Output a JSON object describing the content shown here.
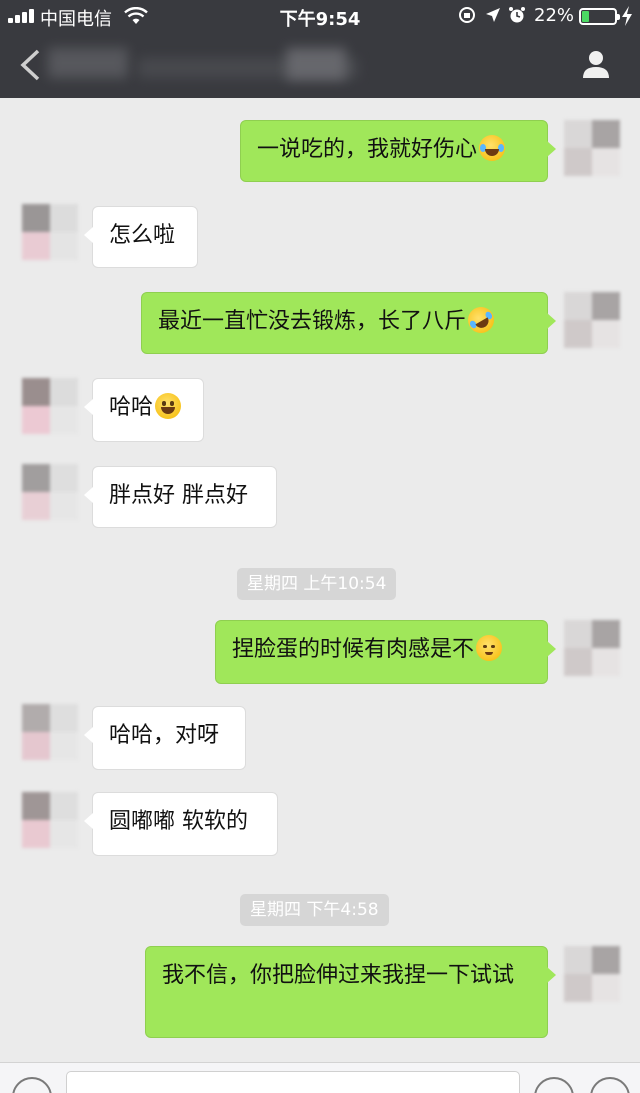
{
  "status_bar": {
    "carrier": "中国电信",
    "time": "下午9:54",
    "battery_percent": "22%",
    "battery_level": 0.22,
    "icons": [
      "signal-icon",
      "wifi-icon",
      "rotation-lock-icon",
      "location-icon",
      "alarm-icon",
      "battery-icon",
      "charging-icon"
    ]
  },
  "nav_bar": {
    "icons": [
      "back-chevron-icon",
      "person-icon"
    ]
  },
  "messages": [
    {
      "side": "out",
      "text": "一说吃的，我就好伤心",
      "emoji": "laugh-cry-emoji-icon"
    },
    {
      "side": "in",
      "text": "怎么啦"
    },
    {
      "side": "out",
      "text": "最近一直忙没去锻炼，长了八斤",
      "emoji": "rolling-laugh-emoji-icon"
    },
    {
      "side": "in",
      "text": "哈哈",
      "emoji": "grin-emoji-icon"
    },
    {
      "side": "in",
      "text": "胖点好 胖点好"
    },
    {
      "side": "out",
      "text": "捏脸蛋的时候有肉感是不",
      "emoji": "blush-emoji-icon"
    },
    {
      "side": "in",
      "text": "哈哈，对呀"
    },
    {
      "side": "in",
      "text": "圆嘟嘟 软软的"
    },
    {
      "side": "out",
      "text": "我不信，你把脸伸过来我捏一下试试"
    }
  ],
  "timestamps": [
    "星期四 上午10:54",
    "星期四 下午4:58"
  ],
  "colors": {
    "header_bg": "#393a3f",
    "chat_bg": "#ebebeb",
    "outgoing_bubble": "#a0e75a",
    "incoming_bubble": "#ffffff",
    "timestamp_bg": "#d6d6d6"
  }
}
